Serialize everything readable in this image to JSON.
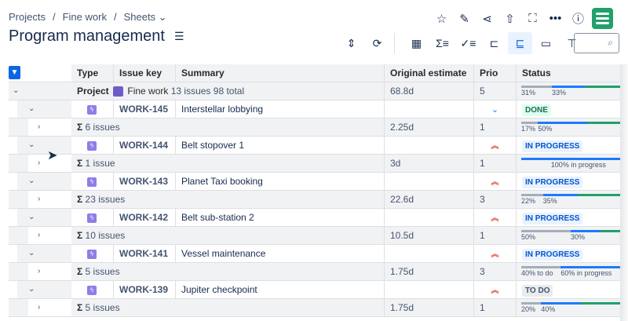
{
  "breadcrumbs": [
    "Projects",
    "/",
    "Fine work",
    "/",
    "Sheets ⌄"
  ],
  "title": "Program management",
  "columns": [
    "Type",
    "Issue key",
    "Summary",
    "Original estimate",
    "Prio",
    "Status"
  ],
  "project_row": {
    "label": "Project",
    "name": "Fine work",
    "issues": "13 issues",
    "total": "98 total",
    "estimate": "68.8d",
    "prio": "5",
    "bar": [
      {
        "pct": 31,
        "color": "#a5adba",
        "label": "31%"
      },
      {
        "pct": 33,
        "color": "#1d7afc",
        "label": "33%"
      },
      {
        "pct": 36,
        "color": "#22a06b",
        "label": ""
      }
    ]
  },
  "items": [
    {
      "key": "WORK-145",
      "summary": "Interstellar lobbying",
      "prio": "low",
      "status": "DONE",
      "status_bg": "#dcfff1",
      "status_fg": "#216e4e",
      "children": "6 issues",
      "estimate": "2.25d",
      "cprio": "1",
      "bar": [
        {
          "pct": 17,
          "color": "#a5adba",
          "label": "17%"
        },
        {
          "pct": 50,
          "color": "#1d7afc",
          "label": "50%"
        },
        {
          "pct": 33,
          "color": "#22a06b",
          "label": ""
        }
      ]
    },
    {
      "key": "WORK-144",
      "summary": "Belt stopover 1",
      "prio": "highest",
      "status": "IN PROGRESS",
      "status_bg": "#e9f2ff",
      "status_fg": "#0055cc",
      "children": "1 issue",
      "estimate": "3d",
      "cprio": "1",
      "bar": [
        {
          "pct": 100,
          "color": "#1d7afc",
          "label": "100% in progress"
        }
      ]
    },
    {
      "key": "WORK-143",
      "summary": "Planet Taxi booking",
      "prio": "highest",
      "status": "IN PROGRESS",
      "status_bg": "#e9f2ff",
      "status_fg": "#0055cc",
      "children": "23 issues",
      "estimate": "22.6d",
      "cprio": "3",
      "bar": [
        {
          "pct": 22,
          "color": "#a5adba",
          "label": "22%"
        },
        {
          "pct": 35,
          "color": "#1d7afc",
          "label": "35%"
        },
        {
          "pct": 43,
          "color": "#22a06b",
          "label": ""
        }
      ]
    },
    {
      "key": "WORK-142",
      "summary": "Belt sub-station 2",
      "prio": "highest",
      "status": "IN PROGRESS",
      "status_bg": "#e9f2ff",
      "status_fg": "#0055cc",
      "children": "10 issues",
      "estimate": "10.5d",
      "cprio": "1",
      "bar": [
        {
          "pct": 50,
          "color": "#a5adba",
          "label": "50%"
        },
        {
          "pct": 30,
          "color": "#1d7afc",
          "label": "30%"
        },
        {
          "pct": 20,
          "color": "#22a06b",
          "label": ""
        }
      ]
    },
    {
      "key": "WORK-141",
      "summary": "Vessel maintenance",
      "prio": "highest",
      "status": "IN PROGRESS",
      "status_bg": "#e9f2ff",
      "status_fg": "#0055cc",
      "children": "5 issues",
      "estimate": "1.75d",
      "cprio": "3",
      "bar": [
        {
          "pct": 40,
          "color": "#a5adba",
          "label": "40% to do"
        },
        {
          "pct": 60,
          "color": "#1d7afc",
          "label": "60% in progress"
        }
      ]
    },
    {
      "key": "WORK-139",
      "summary": "Jupiter checkpoint",
      "prio": "highest",
      "status": "TO DO",
      "status_bg": "#e9ebee",
      "status_fg": "#44546f",
      "children": "5 issues",
      "estimate": "1.75d",
      "cprio": "1",
      "bar": [
        {
          "pct": 20,
          "color": "#a5adba",
          "label": "20%"
        },
        {
          "pct": 40,
          "color": "#1d7afc",
          "label": "40%"
        },
        {
          "pct": 40,
          "color": "#22a06b",
          "label": ""
        }
      ]
    }
  ],
  "icons": {
    "top": [
      "star-icon",
      "pencil-icon",
      "share-icon",
      "export-icon",
      "fullscreen-icon",
      "more-icon",
      "help-icon"
    ],
    "toolbar": [
      "collapse-icon",
      "refresh-icon",
      "timeline-icon",
      "sum-icon",
      "checklist-icon",
      "hierarchy-icon",
      "tree-icon",
      "rows-icon",
      "paint-roller-icon"
    ]
  }
}
